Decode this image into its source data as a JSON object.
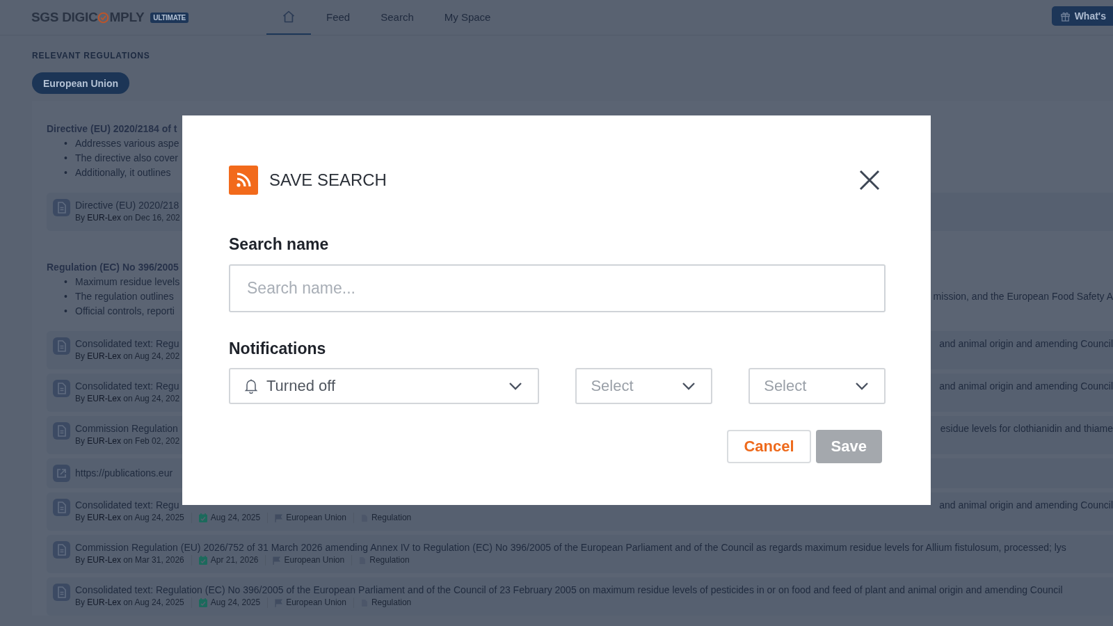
{
  "header": {
    "logo_start": "SGS DIGIC",
    "logo_end": "MPLY",
    "edition_badge": "ULTIMATE",
    "nav": [
      {
        "kind": "home",
        "selected": true
      },
      {
        "kind": "text",
        "label": "Feed",
        "selected": false
      },
      {
        "kind": "text",
        "label": "Search",
        "selected": false
      },
      {
        "kind": "text",
        "label": "My Space",
        "selected": false
      }
    ],
    "whats_new_button": "What's"
  },
  "section_label": "RELEVANT REGULATIONS",
  "region_filter": "European Union",
  "groups": [
    {
      "title": "Directive (EU) 2020/2184 of t",
      "bullets": [
        {
          "marker": "•",
          "text": "Addresses various aspe"
        },
        {
          "marker": "•",
          "text": "The directive also cover"
        },
        {
          "marker": "•",
          "text": "Additionally, it outlines"
        }
      ],
      "items": [
        {
          "kind": "document",
          "title": "Directive (EU) 2020/218",
          "byline": "By **EUR-Lex** on Dec 16, 202"
        }
      ]
    },
    {
      "title": "Regulation (EC) No 396/2005",
      "bullets": [
        {
          "marker": "•",
          "text": "Maximum residue levels"
        },
        {
          "marker": "•",
          "text": "The regulation outlines",
          "text_end": "mission, and the European Food Safety A"
        },
        {
          "marker": "•",
          "text": "Official controls, reporti"
        }
      ],
      "items": [
        {
          "kind": "document",
          "title": "Consolidated text: Regu",
          "title_end": "and animal origin and amending Council",
          "byline": "By **EUR-Lex** on Aug 24, 202"
        },
        {
          "kind": "document",
          "title": "Consolidated text: Regu",
          "title_end": "and animal origin and amending Council",
          "byline": "By **EUR-Lex** on Aug 24, 202"
        },
        {
          "kind": "document",
          "title": "Commission Regulation",
          "title_end": "esidue levels for clothianidin and thiame",
          "byline": "By **EUR-Lex** on Feb 02, 202"
        },
        {
          "kind": "link",
          "title": "https://publications.eur"
        },
        {
          "kind": "document",
          "title": "Consolidated text: Regu",
          "title_end": "and animal origin and amending Council",
          "byline": "By **EUR-Lex** on Aug 24, 2025",
          "published": "Aug 24, 2025",
          "region": "European Union",
          "type": "Regulation"
        },
        {
          "kind": "document",
          "title": "Commission Regulation (EU) 2026/752 of 31 March 2026 amending Annex IV to Regulation (EC) No 396/2005 of the European Parliament and of the Council as regards maximum residue levels for Allium fistulosum, processed; lys",
          "byline": "By **EUR-Lex** on Mar 31, 2026",
          "published": "Apr 21, 2026",
          "region": "European Union",
          "type": "Regulation"
        },
        {
          "kind": "document",
          "title": "Consolidated text: Regulation (EC) No 396/2005 of the European Parliament and of the Council of 23 February 2005 on maximum residue levels of pesticides in or on food and feed of plant and animal origin and amending Council",
          "byline": "By **EUR-Lex** on Aug 24, 2025",
          "published": "Aug 24, 2025",
          "region": "European Union",
          "type": "Regulation"
        }
      ]
    }
  ],
  "dialog": {
    "title": "SAVE SEARCH",
    "name_label": "Search name",
    "name_placeholder": "Search name...",
    "notifications_label": "Notifications",
    "dropdowns": [
      {
        "kind": "status",
        "value": "Turned off"
      },
      {
        "kind": "plain",
        "placeholder": "Select"
      },
      {
        "kind": "plain",
        "placeholder": "Select"
      }
    ],
    "buttons": [
      {
        "kind": "cancel",
        "label": "Cancel",
        "disabled": false
      },
      {
        "kind": "save",
        "label": "Save",
        "disabled": true
      }
    ]
  }
}
